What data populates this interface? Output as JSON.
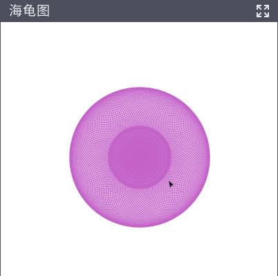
{
  "window": {
    "title": "海龟图"
  },
  "icons": {
    "fullscreen": "expand-arrows-icon",
    "cursor": "turtle-arrow-icon"
  },
  "colors": {
    "titlebar": "#4a505c",
    "title_text": "#e8eaee",
    "pen": "#c463c9",
    "background": "#ffffff"
  }
}
